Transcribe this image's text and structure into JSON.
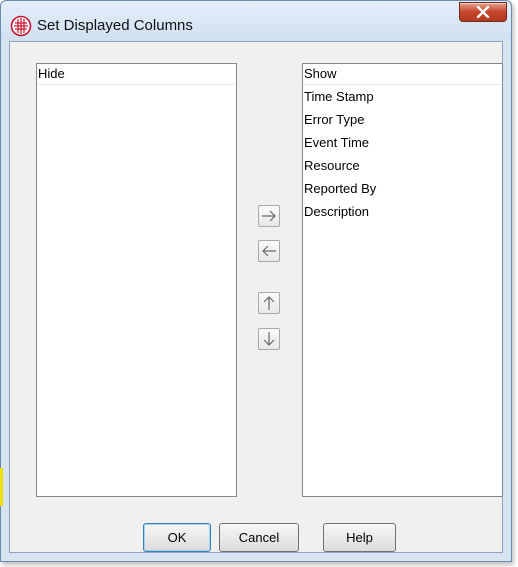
{
  "window": {
    "title": "Set Displayed Columns",
    "app_icon": "globe-grid-icon",
    "close_icon": "close-x-icon",
    "accent_color": "#c5452a"
  },
  "hide_list": {
    "header": "Hide",
    "items": []
  },
  "show_list": {
    "header": "Show",
    "items": [
      "Time Stamp",
      "Error Type",
      "Event Time",
      "Resource",
      "Reported By",
      "Description"
    ]
  },
  "arrow_buttons": {
    "move_right": "arrow-right-icon",
    "move_left": "arrow-left-icon",
    "move_up": "arrow-up-icon",
    "move_down": "arrow-down-icon"
  },
  "buttons": {
    "ok": "OK",
    "cancel": "Cancel",
    "help": "Help"
  }
}
